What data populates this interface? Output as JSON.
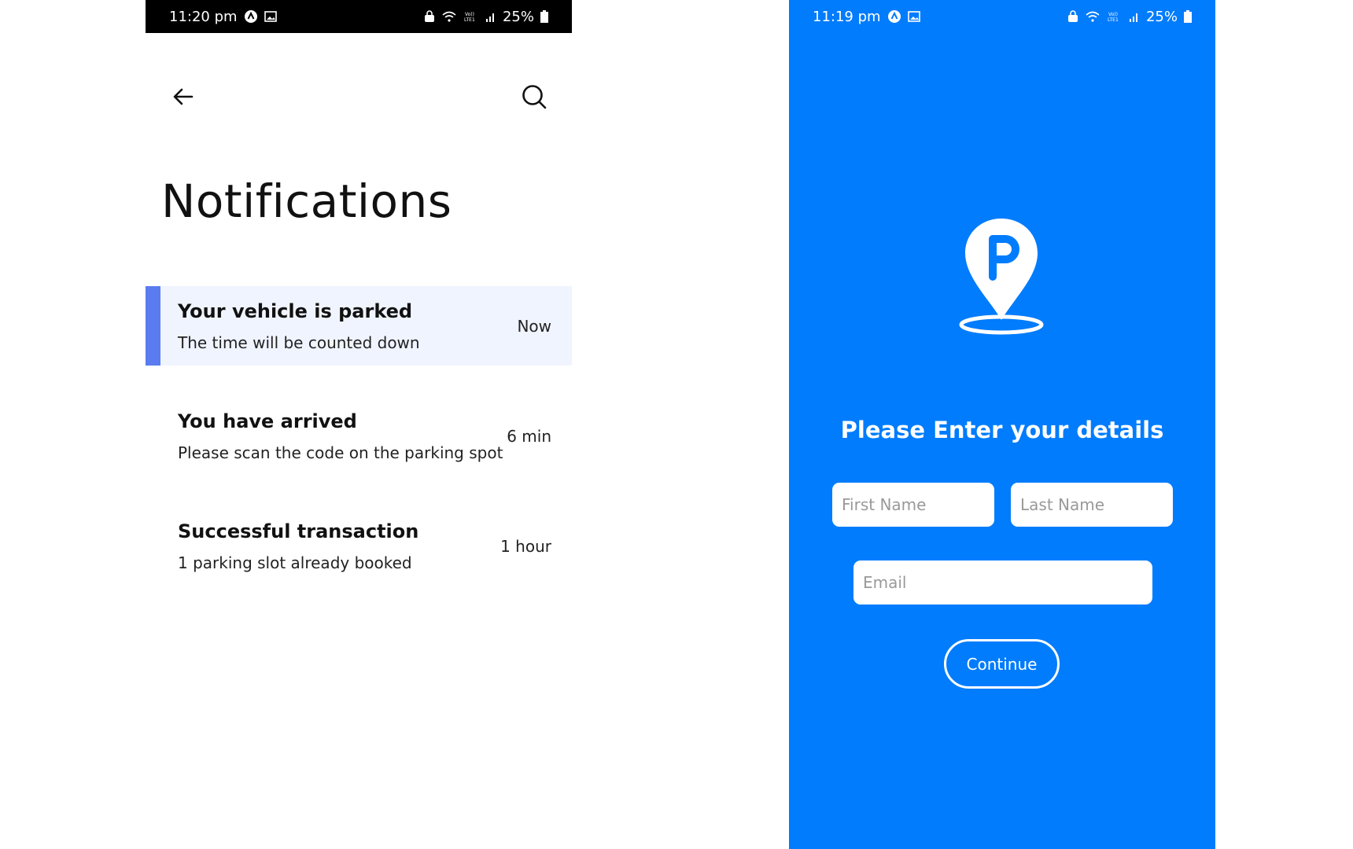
{
  "left_screen": {
    "status_bar": {
      "time": "11:20 pm",
      "battery": "25%"
    },
    "title": "Notifications",
    "notifications": [
      {
        "title": "Your vehicle is parked",
        "subtitle": "The time will be counted down",
        "time": "Now"
      },
      {
        "title": "You have arrived",
        "subtitle": "Please scan the code on the parking spot",
        "time": "6 min"
      },
      {
        "title": "Successful transaction",
        "subtitle": "1 parking slot already booked",
        "time": "1 hour"
      }
    ],
    "icons": {
      "back": "back-arrow-icon",
      "search": "search-icon"
    }
  },
  "right_screen": {
    "status_bar": {
      "time": "11:19 pm",
      "battery": "25%"
    },
    "logo": "parking-pin-icon",
    "heading": "Please Enter your details",
    "first_name_placeholder": "First Name",
    "last_name_placeholder": "Last Name",
    "email_placeholder": "Email",
    "continue_label": "Continue"
  },
  "colors": {
    "primary_blue": "#017cfd",
    "accent_bar": "#5a7cf0",
    "active_bg": "#f0f4ff"
  }
}
